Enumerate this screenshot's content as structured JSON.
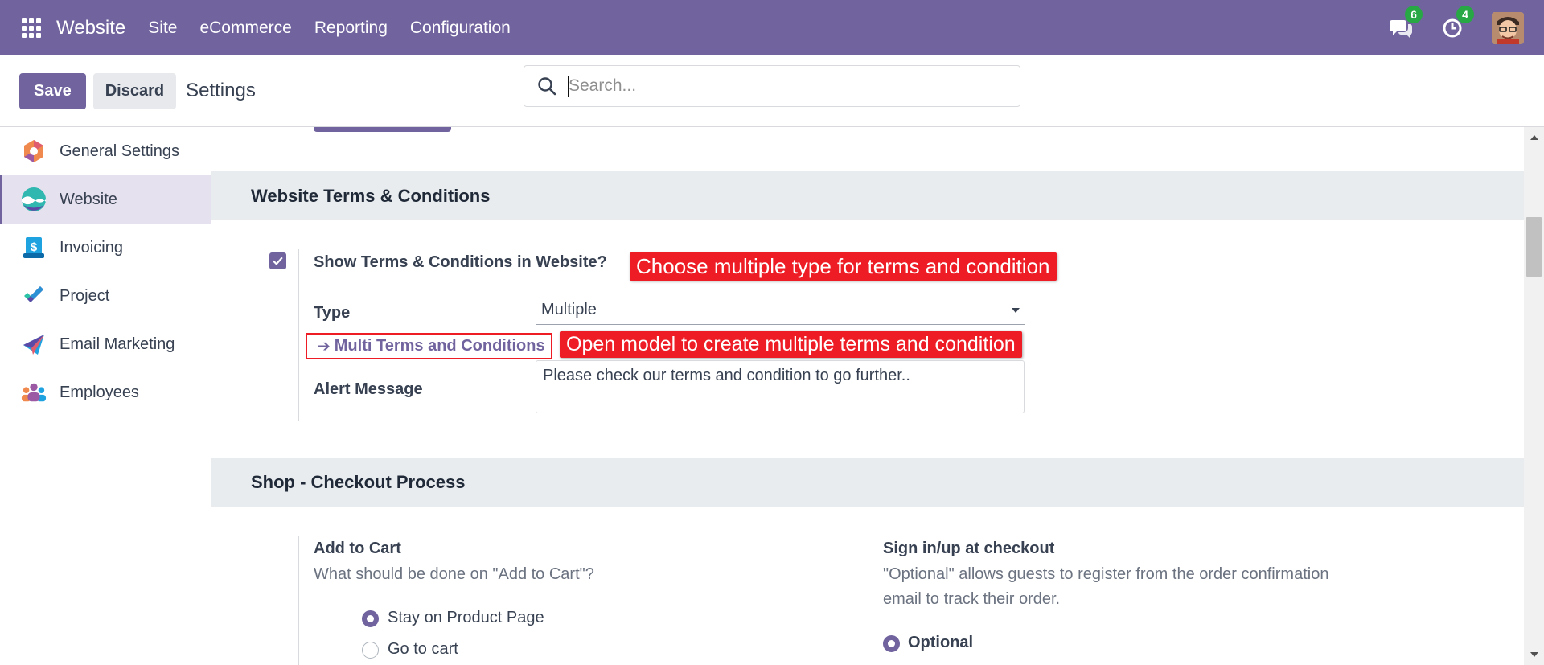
{
  "navbar": {
    "app_name": "Website",
    "menu": [
      "Site",
      "eCommerce",
      "Reporting",
      "Configuration"
    ],
    "messages_count": "6",
    "activities_count": "4",
    "bg_color": "#71639e",
    "badge_color": "#28a745"
  },
  "control_panel": {
    "save_label": "Save",
    "discard_label": "Discard",
    "title": "Settings",
    "search_placeholder": "Search..."
  },
  "sidebar": {
    "items": [
      {
        "label": "General Settings",
        "icon": "general-settings-icon",
        "active": false
      },
      {
        "label": "Website",
        "icon": "website-app-icon",
        "active": true
      },
      {
        "label": "Invoicing",
        "icon": "invoicing-app-icon",
        "active": false
      },
      {
        "label": "Project",
        "icon": "project-app-icon",
        "active": false
      },
      {
        "label": "Email Marketing",
        "icon": "email-marketing-app-icon",
        "active": false
      },
      {
        "label": "Employees",
        "icon": "employees-app-icon",
        "active": false
      }
    ]
  },
  "terms_section": {
    "title": "Website Terms & Conditions",
    "show_terms_label": "Show Terms & Conditions in Website?",
    "show_terms_checked": true,
    "type_label": "Type",
    "type_value": "Multiple",
    "multi_link_label": "Multi Terms and Conditions",
    "alert_label": "Alert Message",
    "alert_value": "Please check our terms and condition to go further.."
  },
  "annotations": {
    "callout_type": "Choose multiple type for terms and condition",
    "callout_link": "Open model to create multiple terms and condition",
    "color": "#ee1c25"
  },
  "checkout_section": {
    "title": "Shop - Checkout Process",
    "add_to_cart": {
      "label": "Add to Cart",
      "help": "What should be done on \"Add to Cart\"?",
      "options": [
        "Stay on Product Page",
        "Go to cart"
      ],
      "selected": "Stay on Product Page"
    },
    "sign_in": {
      "label": "Sign in/up at checkout",
      "help_line1": "\"Optional\" allows guests to register from the order confirmation",
      "help_line2": "email to track their order.",
      "option": "Optional",
      "selected": "Optional"
    }
  },
  "accent_color": "#71639e"
}
